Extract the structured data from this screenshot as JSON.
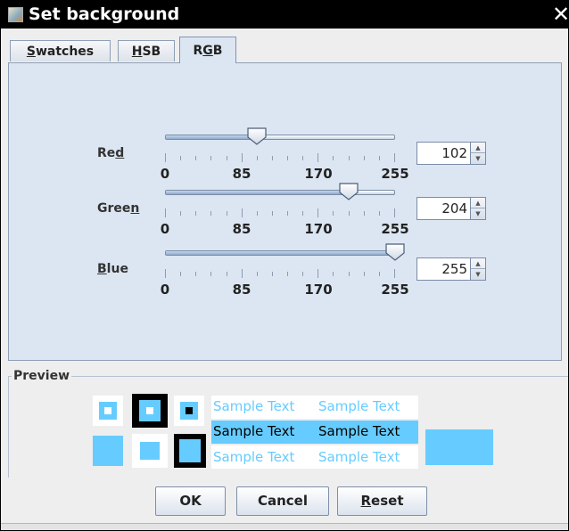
{
  "window": {
    "title": "Set background",
    "icon": "java-cup-icon",
    "close_icon": "close-icon"
  },
  "tabs": [
    {
      "label": "Swatches",
      "mnemonic_index": 0,
      "selected": false
    },
    {
      "label": "HSB",
      "mnemonic_index": 0,
      "selected": false
    },
    {
      "label": "RGB",
      "mnemonic_index": 1,
      "selected": true
    }
  ],
  "rgb": {
    "tick_labels": [
      "0",
      "85",
      "170",
      "255"
    ],
    "slider_max": 255,
    "channels": [
      {
        "name": "Red",
        "mnemonic_index": 2,
        "value": 102
      },
      {
        "name": "Green",
        "mnemonic_index": 4,
        "value": 204
      },
      {
        "name": "Blue",
        "mnemonic_index": 0,
        "value": 255
      }
    ]
  },
  "preview": {
    "title": "Preview",
    "sample_text": "Sample Text",
    "color": "#66ccff"
  },
  "buttons": {
    "ok": {
      "label": "OK"
    },
    "cancel": {
      "label": "Cancel"
    },
    "reset": {
      "label": "Reset",
      "mnemonic_index": 0
    }
  }
}
